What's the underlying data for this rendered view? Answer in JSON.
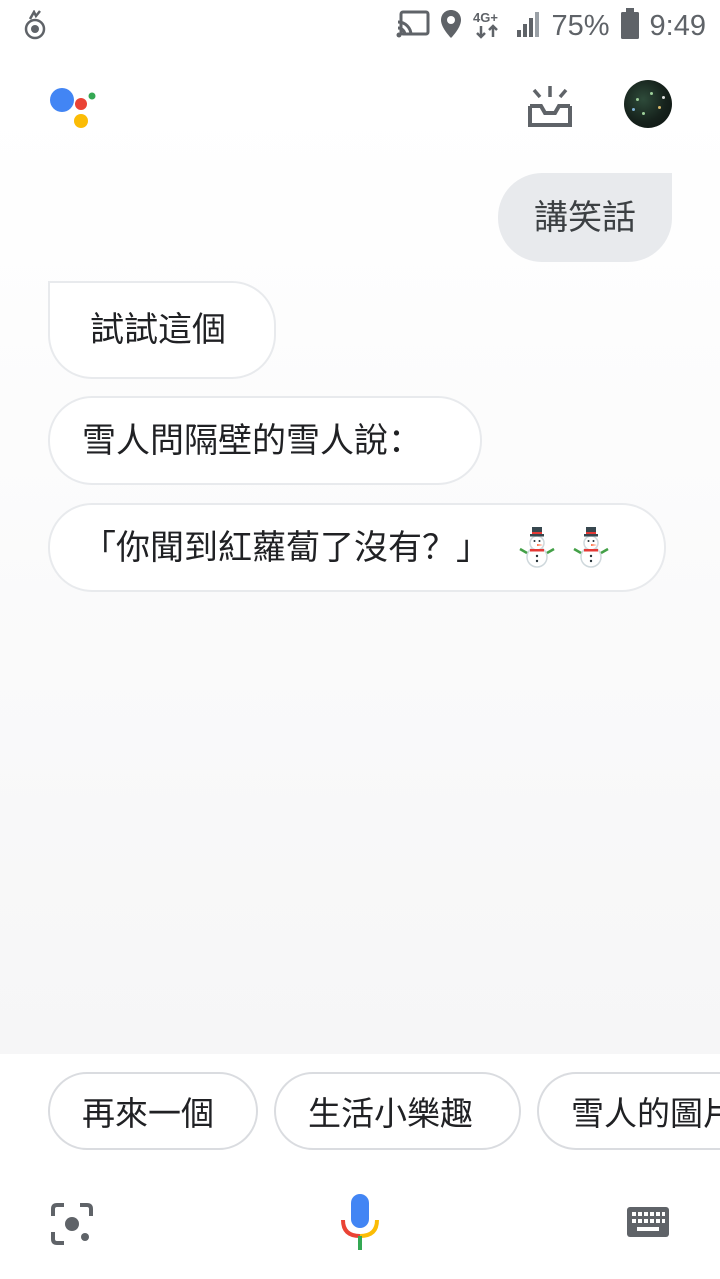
{
  "status_bar": {
    "battery_percent_text": "75%",
    "time": "9:49",
    "network_type": "4G+",
    "icons": [
      "notification-icon",
      "cast-icon",
      "location-icon",
      "network-icon",
      "signal-icon",
      "battery-icon"
    ]
  },
  "header": {
    "logo": "google-assistant-icon",
    "updates_icon": "updates-icon",
    "avatar": "account-avatar"
  },
  "conversation": {
    "user_message": "講笑話",
    "assistant_messages": [
      "試試這個",
      "雪人問隔壁的雪人說：",
      "「你聞到紅蘿蔔了沒有？」"
    ],
    "emoji": "snowman-emoji",
    "emoji_count": 2
  },
  "suggestions": [
    "再來一個",
    "生活小樂趣",
    "雪人的圖片"
  ],
  "bottom_bar": {
    "icons": [
      "lens-icon",
      "mic-icon",
      "keyboard-icon"
    ]
  },
  "colors": {
    "google_blue": "#4285F4",
    "google_red": "#EA4335",
    "google_yellow": "#FBBC05",
    "google_green": "#34A853",
    "user_bubble": "#E8EAED",
    "icon_gray": "#5F6368"
  }
}
